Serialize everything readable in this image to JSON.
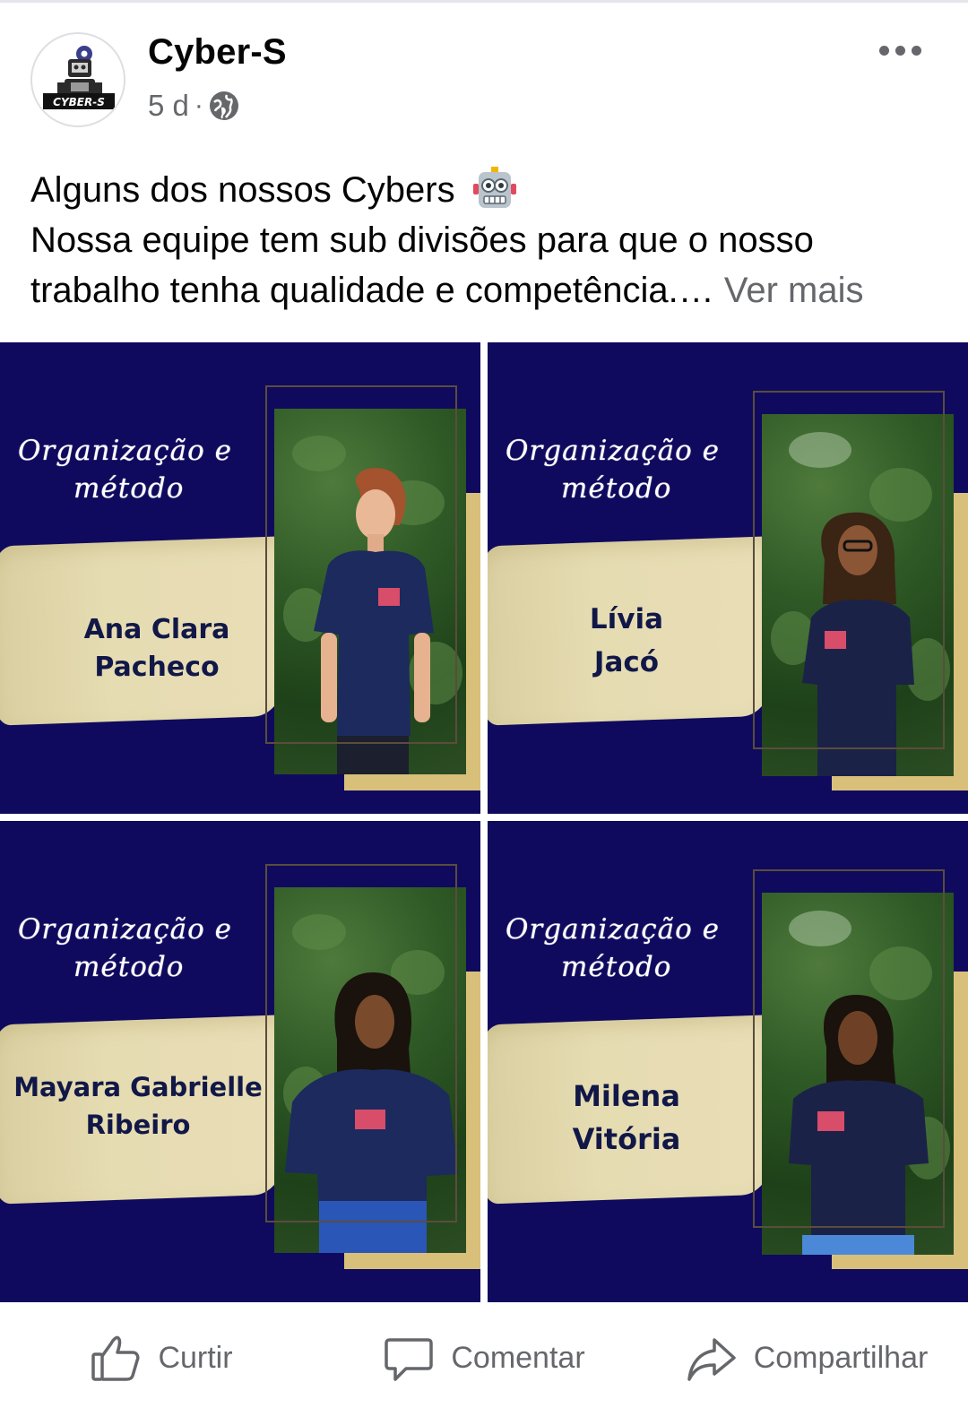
{
  "post": {
    "page_name": "Cyber-S",
    "timestamp": "5 d",
    "separator": "·",
    "avatar_logo_text": "CYBER-S",
    "text_line1": "Alguns dos nossos Cybers",
    "text_line2": "Nossa equipe tem sub divisões para que o nosso",
    "text_line3": "trabalho tenha qualidade e competência.…",
    "see_more": "Ver mais"
  },
  "photos": [
    {
      "title_line1": "Organização e",
      "title_line2": "método",
      "name_line1": "Ana Clara",
      "name_line2": "Pacheco"
    },
    {
      "title_line1": "Organização e",
      "title_line2": "método",
      "name_line1": "Lívia",
      "name_line2": "Jacó"
    },
    {
      "title_line1": "Organização e",
      "title_line2": "método",
      "name_line1": "Mayara Gabrielle",
      "name_line2": "Ribeiro"
    },
    {
      "title_line1": "Organização e",
      "title_line2": "método",
      "name_line1": "Milena",
      "name_line2": "Vitória"
    }
  ],
  "actions": {
    "like": "Curtir",
    "comment": "Comentar",
    "share": "Compartilhar"
  },
  "colors": {
    "tile_background": "#0f0a5e",
    "brush": "#e6dcb2",
    "gold": "#d8c07a",
    "secondary_text": "#65676b"
  }
}
